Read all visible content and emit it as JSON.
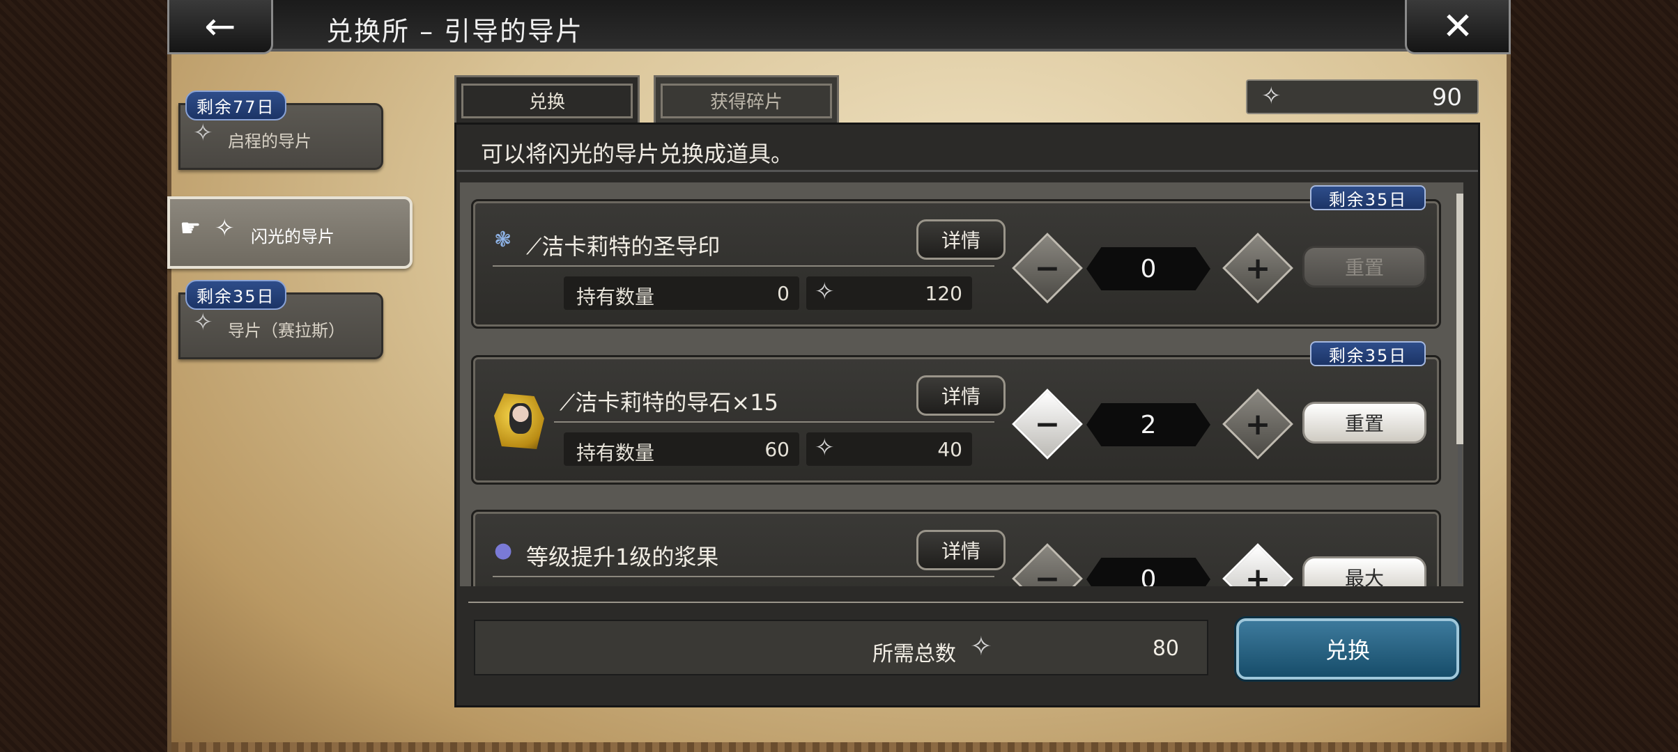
{
  "header": {
    "title": "兑换所 – 引导的导片",
    "back_icon": "←",
    "close_icon": "✕"
  },
  "sidebar": {
    "items": [
      {
        "badge": "剩余77日",
        "label": "启程的导片",
        "active": false
      },
      {
        "badge": "",
        "label": "闪光的导片",
        "active": true
      },
      {
        "badge": "剩余35日",
        "label": "导片（赛拉斯）",
        "active": false
      }
    ]
  },
  "tabs": [
    {
      "label": "兑换",
      "active": true
    },
    {
      "label": "获得碎片",
      "active": false
    }
  ],
  "currency": {
    "value": "90",
    "icon": "shard-icon"
  },
  "instruction": "可以将闪光的导片兑换成道具。",
  "items": [
    {
      "remaining": "剩余35日",
      "name": "洁卡莉特的圣导印",
      "detail_label": "详情",
      "held_label": "持有数量",
      "held_value": "0",
      "cost": "120",
      "quantity": "0",
      "reset_label": "重置",
      "reset_enabled": false
    },
    {
      "remaining": "剩余35日",
      "name": "洁卡莉特的导石×15",
      "detail_label": "详情",
      "held_label": "持有数量",
      "held_value": "60",
      "cost": "40",
      "quantity": "2",
      "reset_label": "重置",
      "reset_enabled": true
    },
    {
      "remaining": "",
      "name": "等级提升1级的浆果",
      "detail_label": "详情",
      "held_label": "",
      "held_value": "",
      "cost": "",
      "quantity": "0",
      "reset_label": "最大",
      "reset_enabled": true
    }
  ],
  "total": {
    "label": "所需总数",
    "value": "80"
  },
  "exchange_button": "兑换",
  "symbols": {
    "minus": "−",
    "plus": "+",
    "shard": "✧"
  }
}
